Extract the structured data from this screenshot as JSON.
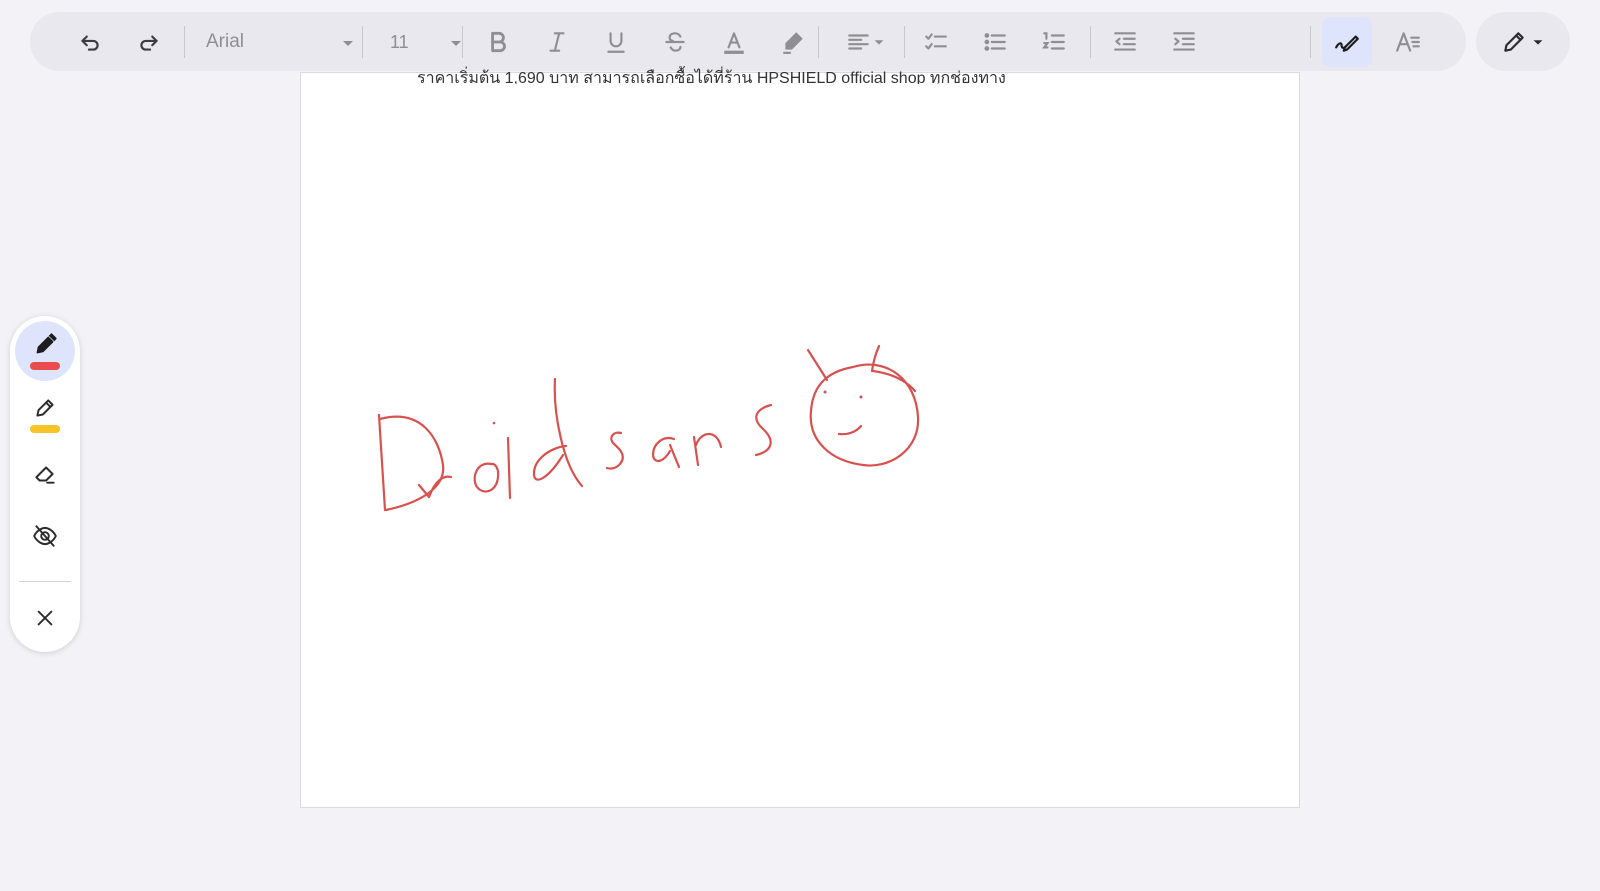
{
  "toolbar": {
    "font_name": "Arial",
    "font_size": "11"
  },
  "document": {
    "visible_text": "ราคาเริ่มต้น 1,690 บาท สามารถเลือกซื้อได้ที่ร้าน HPSHIELD official shop ทุกช่องทาง",
    "handwriting": "Droid sans"
  },
  "colors": {
    "accent": "#dde4fb",
    "pen_color": "#e84c4c",
    "highlighter_color": "#f7c325",
    "ink_color": "#d9514f"
  },
  "side_tools": {
    "items": [
      "pen-tool",
      "highlighter-tool",
      "eraser-tool",
      "hide-markup-tool",
      "close-tool"
    ]
  }
}
